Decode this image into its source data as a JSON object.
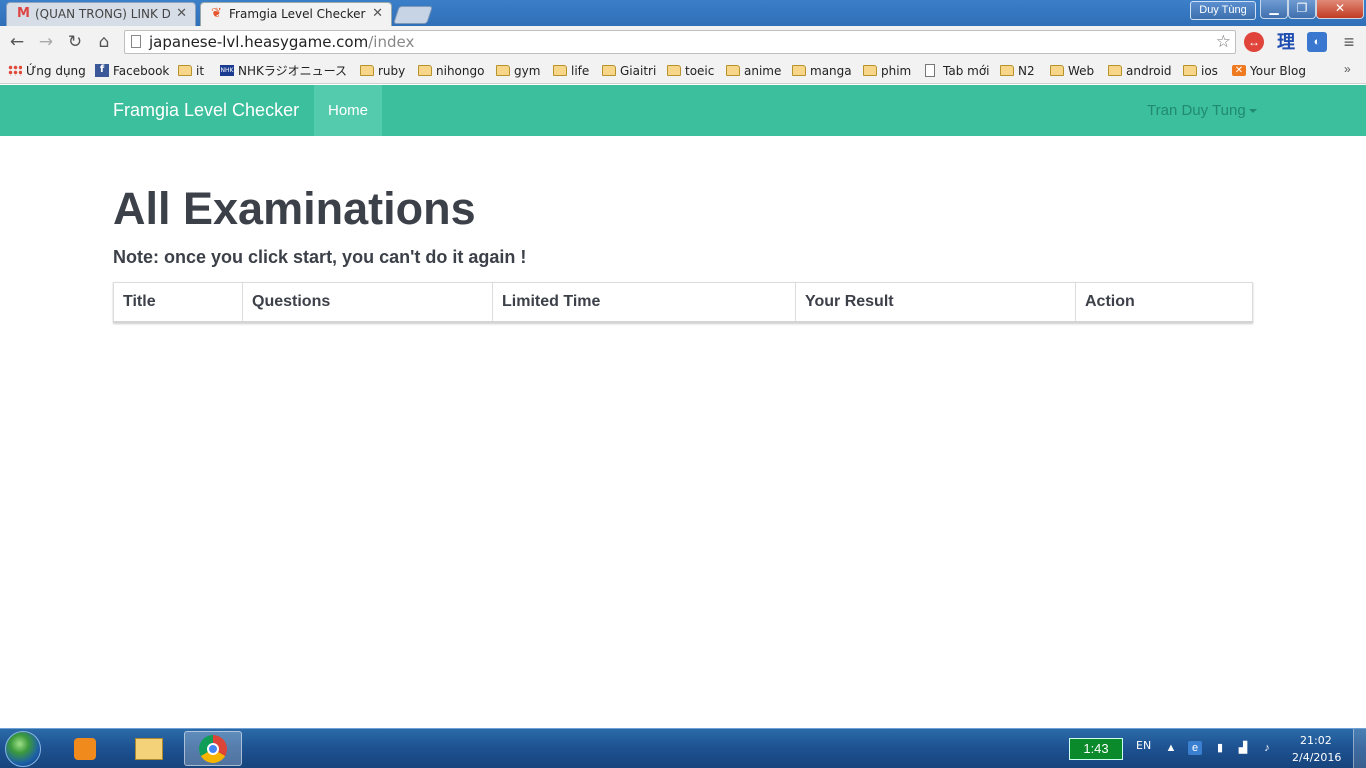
{
  "browser": {
    "tabs": [
      {
        "title": "(QUAN TRONG) LINK DAN",
        "icon": "gmail-icon"
      },
      {
        "title": "Framgia Level Checker",
        "icon": "framgia-icon"
      }
    ],
    "profile_name": "Duy Tùng",
    "url_host": "japanese-lvl.heasygame.com",
    "url_path": "/index",
    "bookmarks": [
      {
        "label": "Ứng dụng",
        "icon": "apps-icon"
      },
      {
        "label": "Facebook",
        "icon": "facebook-icon"
      },
      {
        "label": "it",
        "icon": "folder-icon"
      },
      {
        "label": "NHKラジオニュース",
        "icon": "nhk-icon"
      },
      {
        "label": "ruby",
        "icon": "folder-icon"
      },
      {
        "label": "nihongo",
        "icon": "folder-icon"
      },
      {
        "label": "gym",
        "icon": "folder-icon"
      },
      {
        "label": "life",
        "icon": "folder-icon"
      },
      {
        "label": "Giaitri",
        "icon": "folder-icon"
      },
      {
        "label": "toeic",
        "icon": "folder-icon"
      },
      {
        "label": "anime",
        "icon": "folder-icon"
      },
      {
        "label": "manga",
        "icon": "folder-icon"
      },
      {
        "label": "phim",
        "icon": "folder-icon"
      },
      {
        "label": "Tab mới",
        "icon": "page-icon"
      },
      {
        "label": "N2",
        "icon": "folder-icon"
      },
      {
        "label": "Web",
        "icon": "folder-icon"
      },
      {
        "label": "android",
        "icon": "folder-icon"
      },
      {
        "label": "ios",
        "icon": "folder-icon"
      },
      {
        "label": "Your Blog",
        "icon": "blog-icon"
      }
    ],
    "overflow": "»",
    "ext_kanji": "理"
  },
  "navbar": {
    "brand": "Framgia Level Checker",
    "home": "Home",
    "user": "Tran Duy Tung",
    "color": "#3bbf9c"
  },
  "main": {
    "title": "All Examinations",
    "note": "Note: once you click start, you can't do it again !",
    "columns": [
      "Title",
      "Questions",
      "Limited Time",
      "Your Result",
      "Action"
    ]
  },
  "taskbar": {
    "battery_time": "1:43",
    "language": "EN",
    "time": "21:02",
    "date": "2/4/2016"
  }
}
